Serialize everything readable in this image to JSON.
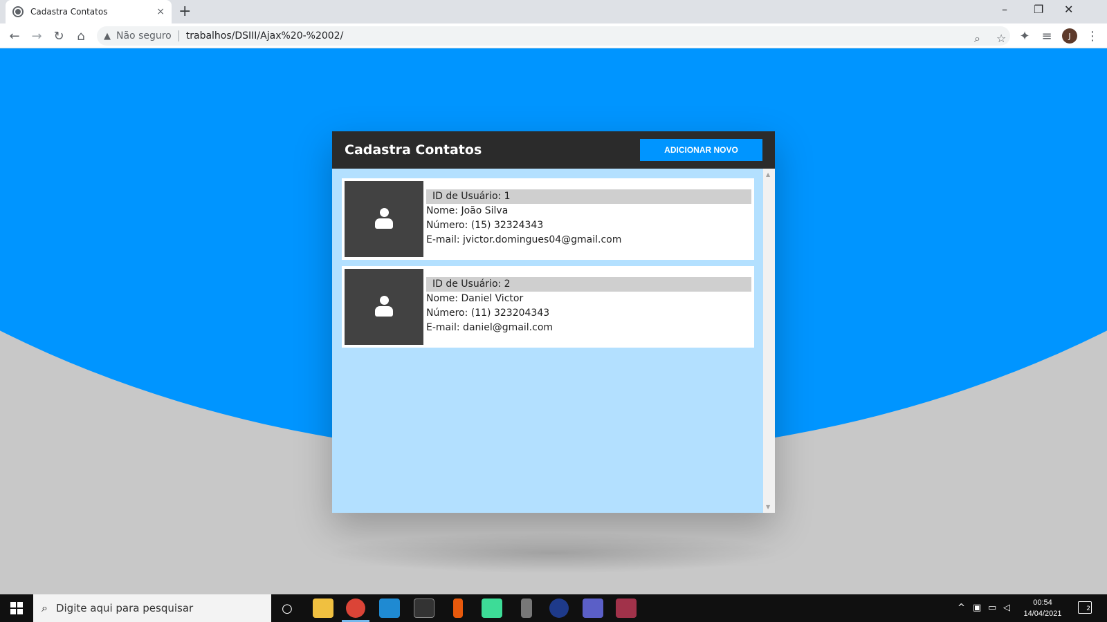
{
  "browser": {
    "tab_title": "Cadastra Contatos",
    "tab_close": "×",
    "new_tab": "+",
    "security_label": "Não seguro",
    "url": "trabalhos/DSIII/Ajax%20-%2002/",
    "profile_initial": "J",
    "window_controls": [
      "–",
      "❐",
      "✕"
    ]
  },
  "app": {
    "title": "Cadastra Contatos",
    "add_button_label": "ADICIONAR NOVO",
    "contacts": [
      {
        "id_line": "ID de Usuário: 1",
        "name_line": "Nome: João Silva",
        "number_line": "Número: (15) 32324343",
        "email_line": "E-mail: jvictor.domingues04@gmail.com"
      },
      {
        "id_line": "ID de Usuário: 2",
        "name_line": "Nome: Daniel Victor",
        "number_line": "Número: (11) 323204343",
        "email_line": "E-mail: daniel@gmail.com"
      }
    ]
  },
  "colors": {
    "accent_blue": "#0095ff",
    "header_dark": "#2b2b2b",
    "light_blue": "#b3e0ff",
    "background_gray": "#c8c8c8"
  },
  "taskbar": {
    "search_placeholder": "Digite aqui para pesquisar",
    "apps": [
      "cortana-icon",
      "file-explorer-icon",
      "chrome-icon",
      "vscode-icon",
      "terminal-icon",
      "microphone-icon",
      "chat-app-icon",
      "recorder-icon",
      "browser-icon",
      "teams-icon",
      "winrar-icon"
    ],
    "time": "00:54",
    "date": "14/04/2021",
    "notification_count": "2"
  }
}
